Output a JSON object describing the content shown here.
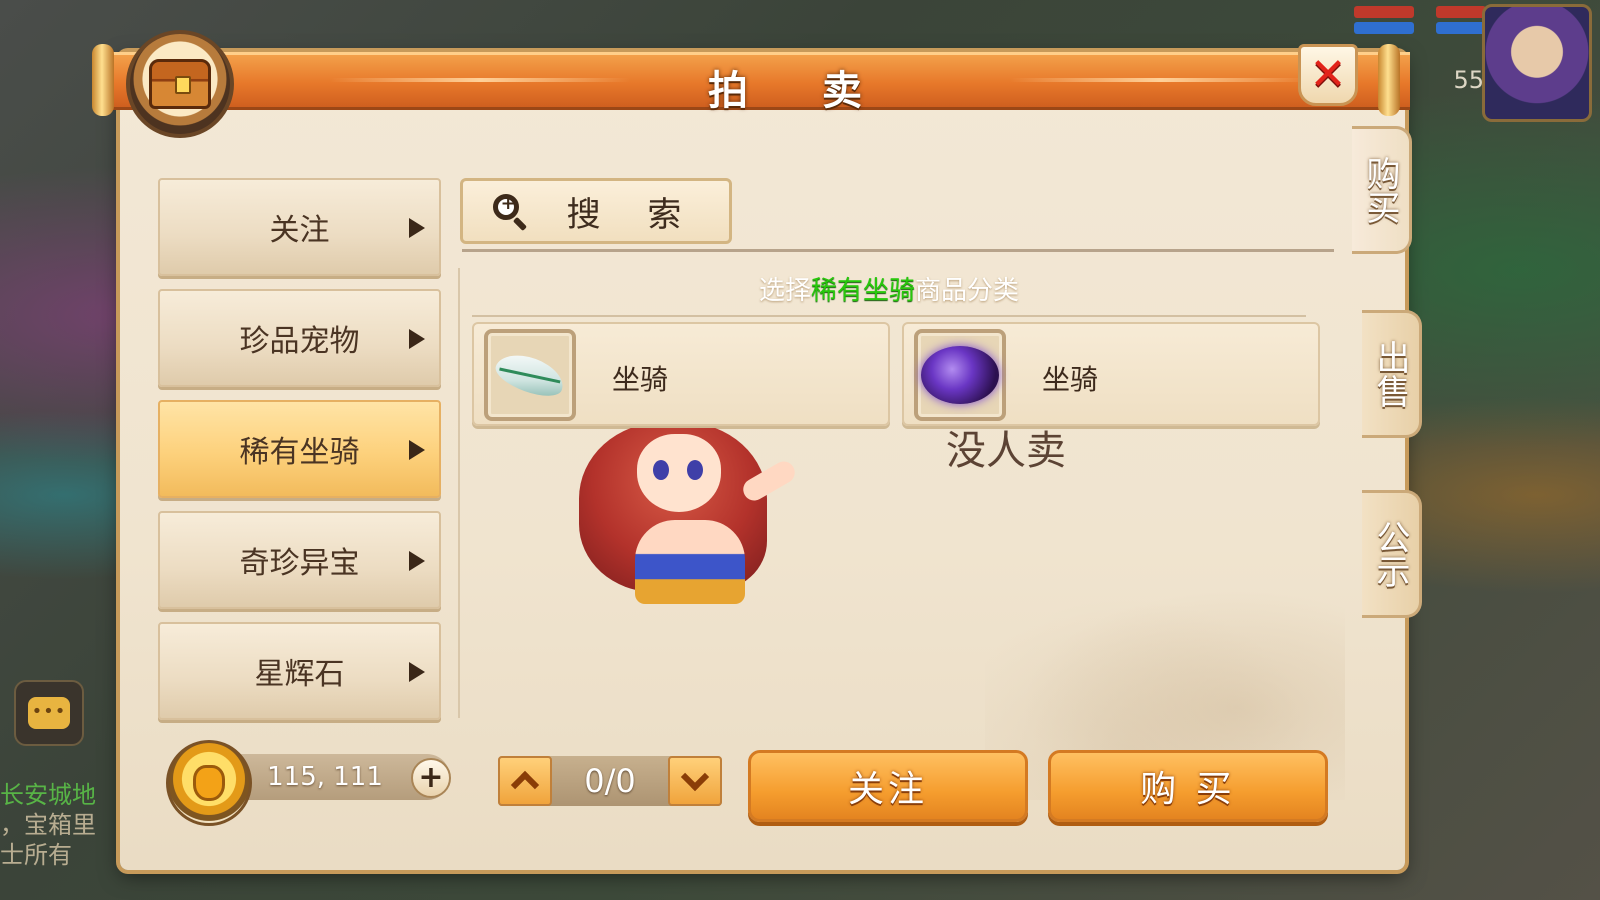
{
  "dialog": {
    "title": "拍 卖",
    "close_label": "✕"
  },
  "categories": [
    {
      "label": "关注",
      "active": false
    },
    {
      "label": "珍品宠物",
      "active": false
    },
    {
      "label": "稀有坐骑",
      "active": true
    },
    {
      "label": "奇珍异宝",
      "active": false
    },
    {
      "label": "星辉石",
      "active": false
    }
  ],
  "search": {
    "label": "搜 索",
    "icon": "magnifier-icon"
  },
  "hint": {
    "prefix": "选择",
    "highlight": "稀有坐骑",
    "suffix": "商品分类"
  },
  "items": [
    {
      "name": "坐骑",
      "icon": "feather-mount-icon"
    },
    {
      "name": "坐骑",
      "icon": "purple-cloud-mount-icon"
    }
  ],
  "empty_message": "没人卖",
  "side_tabs": [
    "购买",
    "出售",
    "公示"
  ],
  "currency": {
    "amount": "115, 111",
    "add_label": "+"
  },
  "pager": {
    "text": "0/0"
  },
  "actions": {
    "follow": "关注",
    "buy": "购 买"
  },
  "background": {
    "left_lines": [
      "长安城地",
      "，宝箱里",
      "士所有"
    ],
    "level": "55"
  },
  "colors": {
    "title_bar": "#e7782a",
    "highlight_green": "#28c80c",
    "action_button": "#f59d2e",
    "close_x": "#e2231a"
  }
}
